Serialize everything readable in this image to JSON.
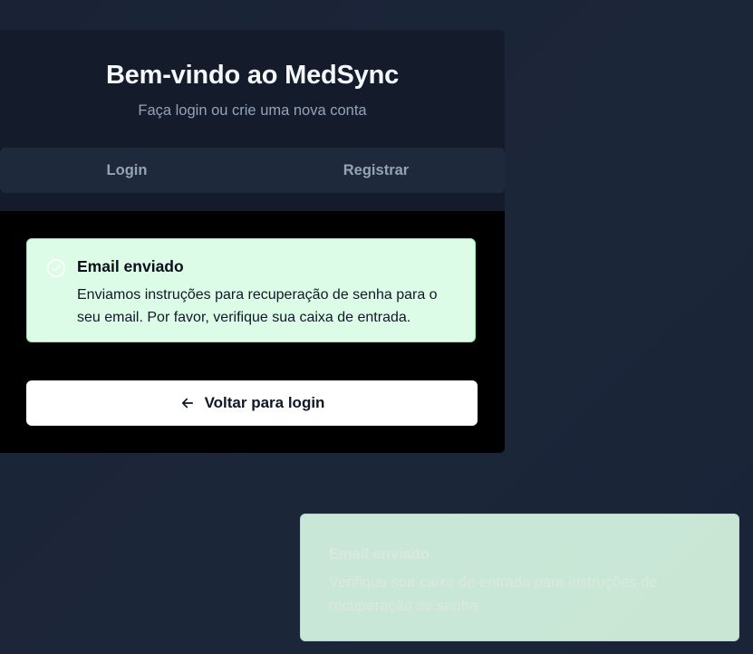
{
  "header": {
    "title": "Bem-vindo ao MedSync",
    "subtitle": "Faça login ou crie uma nova conta"
  },
  "tabs": [
    {
      "label": "Login"
    },
    {
      "label": "Registrar"
    }
  ],
  "alert": {
    "icon": "check-circle-icon",
    "title": "Email enviado",
    "body": "Enviamos instruções para recuperação de senha para o seu email. Por favor, verifique sua caixa de entrada."
  },
  "back_button": {
    "icon": "arrow-left-icon",
    "label": "Voltar para login"
  },
  "toast": {
    "title": "Email enviado",
    "body": "Verifique sua caixa de entrada para instruções de recuperação de senha"
  },
  "colors": {
    "background": "#1c2639",
    "card": "#141c2c",
    "tab_bar": "#1e293b",
    "content": "#000000",
    "success_bg": "#dcfce7",
    "success_border": "#86efac",
    "button_bg": "#ffffff"
  }
}
